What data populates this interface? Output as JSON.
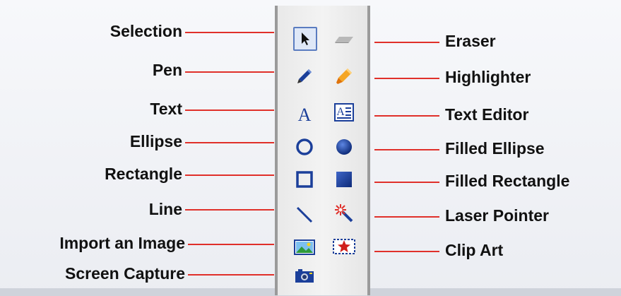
{
  "left_labels": [
    "Selection",
    "Pen",
    "Text",
    "Ellipse",
    "Rectangle",
    "Line",
    "Import an Image",
    "Screen Capture"
  ],
  "right_labels": [
    "Eraser",
    "Highlighter",
    "Text Editor",
    "Filled Ellipse",
    "Filled Rectangle",
    "Laser Pointer",
    "Clip Art"
  ],
  "tools_left": [
    "selection-icon",
    "pen-icon",
    "text-icon",
    "ellipse-icon",
    "rectangle-icon",
    "line-icon",
    "import-image-icon",
    "screen-capture-icon"
  ],
  "tools_right": [
    "eraser-icon",
    "highlighter-icon",
    "text-editor-icon",
    "filled-ellipse-icon",
    "filled-rectangle-icon",
    "laser-pointer-icon",
    "clip-art-icon"
  ],
  "colors": {
    "connector": "#e0302a",
    "tool_blue": "#1b3f9a",
    "text": "#111111"
  }
}
